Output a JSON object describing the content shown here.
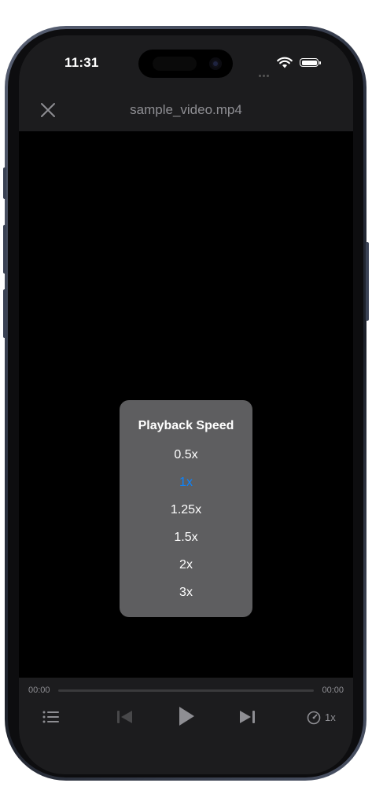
{
  "status_bar": {
    "time": "11:31"
  },
  "nav": {
    "title": "sample_video.mp4"
  },
  "speed_menu": {
    "title": "Playback Speed",
    "options": [
      "0.5x",
      "1x",
      "1.25x",
      "1.5x",
      "2x",
      "3x"
    ],
    "selected": "1x",
    "selected_color": "#0a84ff"
  },
  "player": {
    "current_time": "00:00",
    "total_time": "00:00",
    "progress": 0,
    "speed": "1x"
  },
  "icons": {
    "close": "close-icon",
    "playlist": "list-icon",
    "previous": "skip-previous-icon",
    "play": "play-icon",
    "next": "skip-next-icon",
    "speed": "speedometer-icon"
  }
}
